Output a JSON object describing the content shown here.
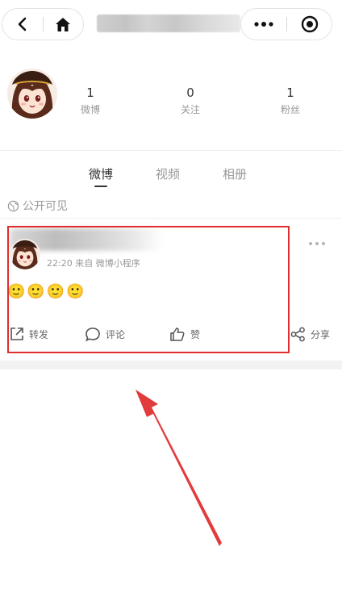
{
  "header": {
    "back_icon": "chevron-left-icon",
    "home_icon": "home-icon",
    "more_icon": "more-dots-icon",
    "close_icon": "target-circle-icon"
  },
  "profile": {
    "stats": [
      {
        "value": "1",
        "label": "微博"
      },
      {
        "value": "0",
        "label": "关注"
      },
      {
        "value": "1",
        "label": "粉丝"
      }
    ]
  },
  "tabs": [
    {
      "label": "微博",
      "active": true
    },
    {
      "label": "视频",
      "active": false
    },
    {
      "label": "相册",
      "active": false
    }
  ],
  "visibility": {
    "label": "公开可见",
    "icon": "globe-icon"
  },
  "post": {
    "meta": "22:20 来自 微博小程序",
    "emojis": "🙂🙂🙂🙂",
    "actions": {
      "repost": "转发",
      "comment": "评论",
      "like": "赞",
      "share": "分享"
    }
  },
  "colors": {
    "highlight": "#e02d2d",
    "arrow": "#e23b3b"
  }
}
